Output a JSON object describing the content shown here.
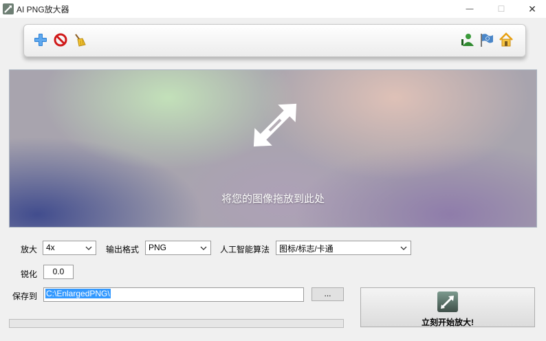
{
  "window": {
    "title": "AI PNG放大器",
    "minimize_glyph": "—",
    "maximize_glyph": "☐",
    "close_glyph": "✕"
  },
  "toolbar": {
    "left_icons": [
      "add-icon",
      "stop-icon",
      "broom-icon"
    ],
    "right_icons": [
      "user-icon",
      "flag-icon",
      "home-icon"
    ]
  },
  "dropzone": {
    "text": "将您的图像拖放到此处",
    "icon": "resize-arrow-icon"
  },
  "form": {
    "scale_label": "放大",
    "scale_value": "4x",
    "format_label": "输出格式",
    "format_value": "PNG",
    "algorithm_label": "人工智能算法",
    "algorithm_value": "图标/标志/卡通",
    "sharpen_label": "锐化",
    "sharpen_value": "0.0",
    "save_label": "保存到",
    "save_path": "C:\\EnlargedPNG\\",
    "browse_label": "..."
  },
  "progress": {
    "value": 0
  },
  "start_button": {
    "label": "立刻开始放大!",
    "icon": "enlarge-icon"
  },
  "colors": {
    "accent": "#3399ff",
    "progress": "#06b025"
  }
}
